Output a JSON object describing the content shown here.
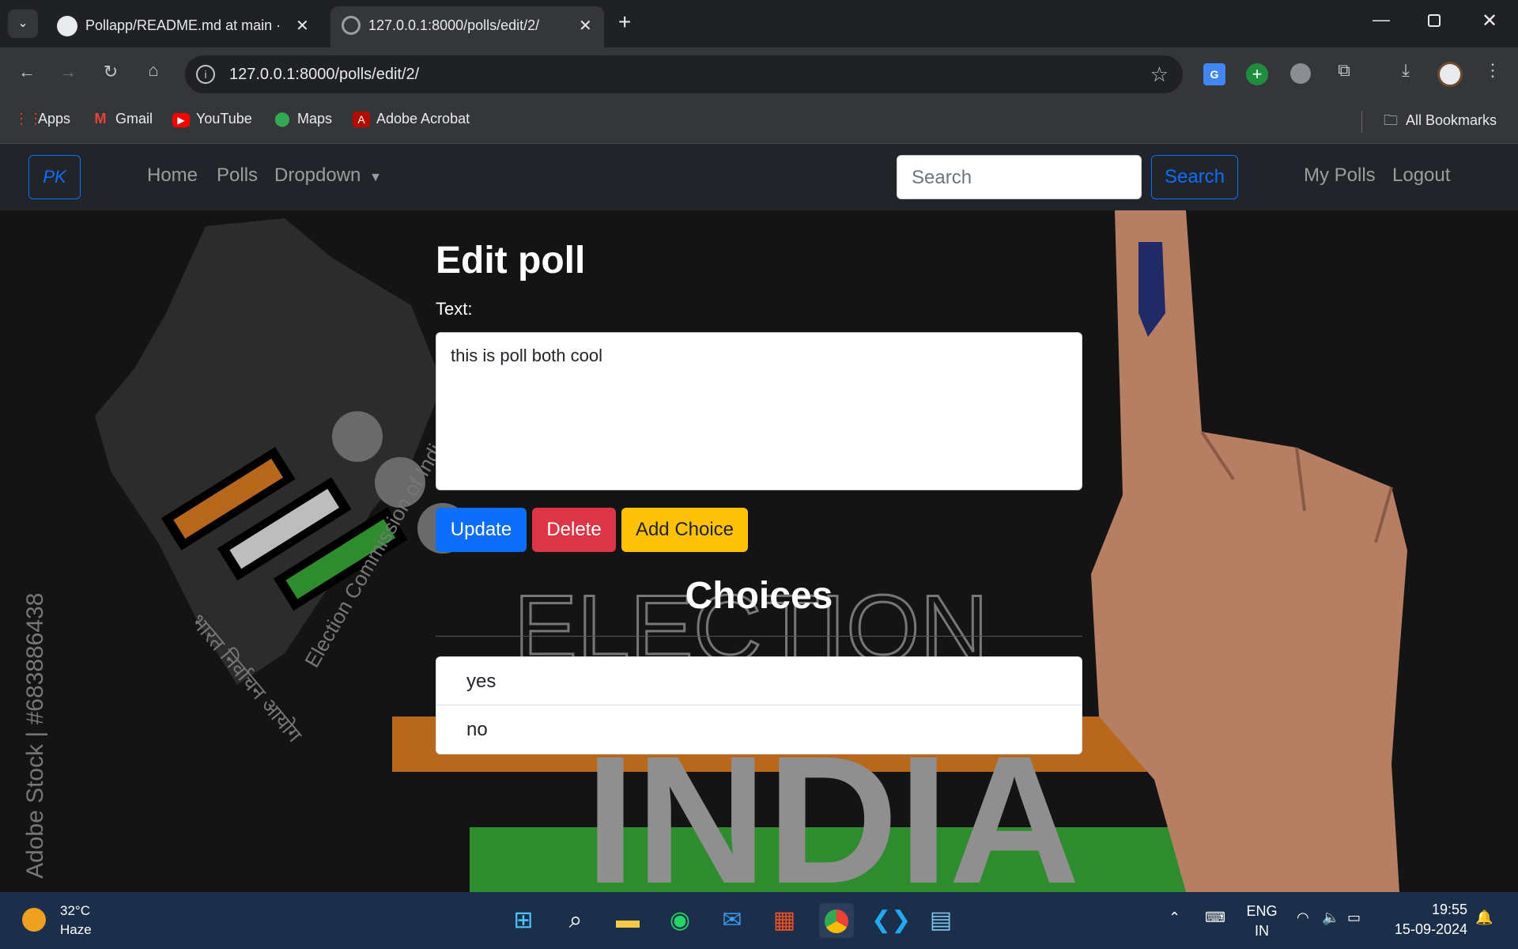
{
  "browser": {
    "tabs": [
      {
        "title": "Pollapp/README.md at main · I",
        "icon": "github-icon"
      },
      {
        "title": "127.0.0.1:8000/polls/edit/2/",
        "icon": "globe-icon"
      }
    ],
    "url": "127.0.0.1:8000/polls/edit/2/",
    "bookmarks": [
      {
        "label": "Apps",
        "icon": "apps-grid-icon"
      },
      {
        "label": "Gmail",
        "icon": "gmail-icon"
      },
      {
        "label": "YouTube",
        "icon": "youtube-icon"
      },
      {
        "label": "Maps",
        "icon": "maps-icon"
      },
      {
        "label": "Adobe Acrobat",
        "icon": "acrobat-icon"
      }
    ],
    "all_bookmarks": "All Bookmarks"
  },
  "navbar": {
    "brand": "PK",
    "links": [
      "Home",
      "Polls",
      "Dropdown"
    ],
    "search_placeholder": "Search",
    "search_button": "Search",
    "right_links": [
      "My Polls",
      "Logout"
    ]
  },
  "page": {
    "title": "Edit poll",
    "text_label": "Text:",
    "text_value": "this is poll both cool",
    "buttons": {
      "update": "Update",
      "delete": "Delete",
      "add_choice": "Add Choice"
    },
    "choices_heading": "Choices",
    "choices": [
      "yes",
      "no"
    ]
  },
  "background": {
    "watermark": "Adobe Stock | #683886438",
    "banner_top": "ELECTION",
    "banner_word": "INDIA",
    "emblem_text": "Election Commission of India",
    "emblem_text_hindi": "भारत निर्वाचन आयोग"
  },
  "taskbar": {
    "weather_temp": "32°C",
    "weather_desc": "Haze",
    "lang_line1": "ENG",
    "lang_line2": "IN",
    "time": "19:55",
    "date": "15-09-2024"
  },
  "colors": {
    "primary": "#0d6efd",
    "danger": "#dc3545",
    "warning": "#ffc107",
    "navbar": "#212529"
  }
}
